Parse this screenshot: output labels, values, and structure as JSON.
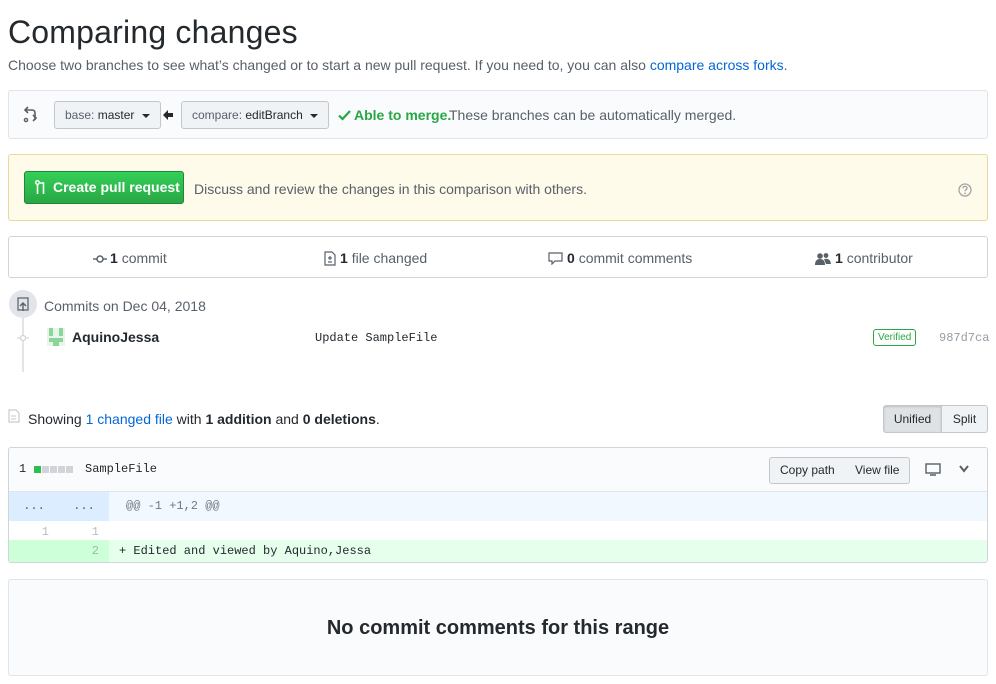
{
  "header": {
    "title": "Comparing changes",
    "subtitle_prefix": "Choose two branches to see what’s changed or to start a new pull request. If you need to, you can also",
    "subtitle_link": "compare across forks",
    "subtitle_suffix": "."
  },
  "range": {
    "base_prefix": "base:",
    "base_branch": "master",
    "compare_prefix": "compare:",
    "compare_branch": "editBranch",
    "merge_status": "Able to merge.",
    "merge_message": "These branches can be automatically merged."
  },
  "flash": {
    "create_pr_label": "Create pull request",
    "description": "Discuss and review the changes in this comparison with others."
  },
  "summary": {
    "commits_count": "1",
    "commits_label": "commit",
    "files_count": "1",
    "files_label": "file changed",
    "comments_count": "0",
    "comments_label": "commit comments",
    "contributors_count": "1",
    "contributors_label": "contributor"
  },
  "commits": {
    "group_title": "Commits on Dec 04, 2018",
    "items": [
      {
        "author": "AquinoJessa",
        "message": "Update SampleFile",
        "badge": "Verified",
        "sha": "987d7ca"
      }
    ]
  },
  "toc": {
    "showing": "Showing",
    "changed_files_link": "1 changed file",
    "with": "with",
    "additions": "1 addition",
    "and": "and",
    "deletions": "0 deletions",
    "period": ".",
    "unified_label": "Unified",
    "split_label": "Split"
  },
  "file": {
    "change_count": "1",
    "name": "SampleFile",
    "copy_path_label": "Copy path",
    "view_file_label": "View file",
    "hunk_left": "...",
    "hunk_right": "...",
    "hunk_header": "@@ -1 +1,2 @@",
    "lines": [
      {
        "left": "1",
        "right": "1",
        "type": "context",
        "code": ""
      },
      {
        "left": "",
        "right": "2",
        "type": "addition",
        "code": "+ Edited and viewed by Aquino,Jessa"
      }
    ]
  },
  "blankslate": {
    "title": "No commit comments for this range"
  },
  "colors": {
    "green": "#28a745",
    "link": "#0366d6",
    "addition_bg": "#e6ffed",
    "addition_num_bg": "#cdffd8",
    "hunk_bg": "#f1f8ff",
    "hunk_num_bg": "#dbedff"
  }
}
